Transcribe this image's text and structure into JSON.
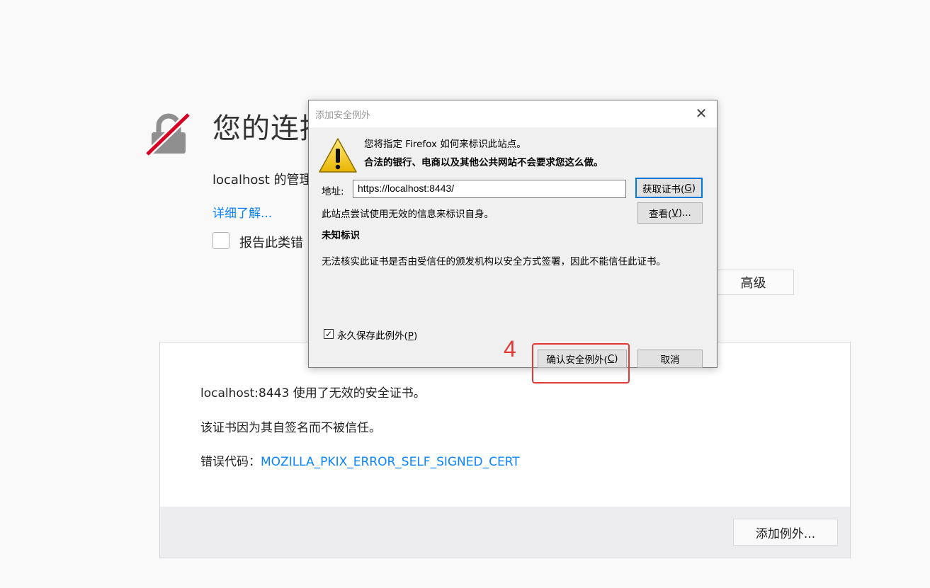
{
  "error_page": {
    "title": "您的连接",
    "description": "localhost 的管理                                                                                    站建立连接。",
    "learn_more": "详细了解...",
    "report_label": "报告此类错",
    "advanced_button": "高级",
    "details": {
      "line1": "localhost:8443 使用了无效的安全证书。",
      "line2": "该证书因为其自签名而不被信任。",
      "error_code_label": "错误代码：",
      "error_code": "MOZILLA_PKIX_ERROR_SELF_SIGNED_CERT",
      "add_exception_button": "添加例外..."
    }
  },
  "dialog": {
    "title": "添加安全例外",
    "close_icon": "close-icon",
    "intro_line1": "您将指定 Firefox 如何来标识此站点。",
    "intro_line2": "合法的银行、电商以及其他公共网站不会要求您这么做。",
    "address_label": "地址:",
    "address_value": "https://localhost:8443/",
    "get_cert_button": {
      "text": "获取证书(",
      "key": "G",
      "suffix": ")"
    },
    "view_button": {
      "text": "查看(",
      "key": "V",
      "suffix": ")..."
    },
    "site_message": "此站点尝试使用无效的信息来标识自身。",
    "unknown_identity": "未知标识",
    "cert_detail": "无法核实此证书是否由受信任的颁发机构以安全方式签署，因此不能信任此证书。",
    "permanent_checkbox": {
      "checked": true,
      "text": "永久保存此例外(",
      "key": "P",
      "suffix": ")"
    },
    "confirm_button": {
      "text": "确认安全例外(",
      "key": "C",
      "suffix": ")"
    },
    "cancel_button": "取消"
  },
  "annotation": {
    "step_number": "4",
    "color": "#e53935"
  }
}
